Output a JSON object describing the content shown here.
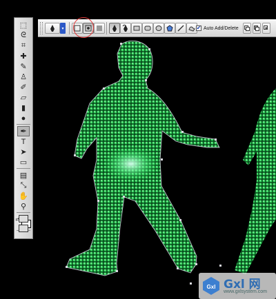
{
  "options_bar": {
    "auto_add_delete_label": "Auto Add/Delete",
    "auto_add_delete_checked": true,
    "icons": [
      "pen-tool-icon",
      "paths-mode-icon",
      "shape-layers-mode-icon",
      "freeform-pen-icon",
      "rectangle-shape-icon",
      "rounded-rectangle-shape-icon",
      "ellipse-shape-icon",
      "polygon-shape-icon",
      "line-shape-icon",
      "custom-shape-icon",
      "path-area-combine-icon"
    ]
  },
  "tools": [
    "marquee",
    "lasso",
    "crop",
    "healing-brush",
    "brush",
    "clone-stamp",
    "history-brush",
    "eraser",
    "gradient",
    "blur",
    "dodge",
    "pen",
    "type",
    "path-selection",
    "rectangle",
    "notes",
    "eyedropper",
    "hand",
    "zoom",
    "color-swatches",
    "quick-mask",
    "screen-mode",
    "jump-to-imageready"
  ],
  "selected_tool": "pen",
  "colors": {
    "highlight": "#e23c3c",
    "signal_green": "#18c040",
    "path": "#b9b9c4"
  },
  "watermark": {
    "title": "Gxl 网",
    "url": "www.gxlsystem.com"
  }
}
